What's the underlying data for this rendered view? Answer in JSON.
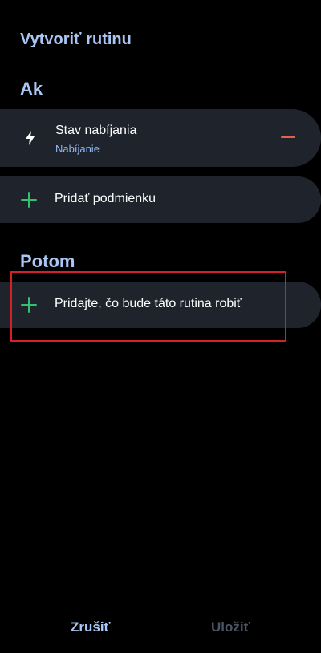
{
  "header": {
    "title": "Vytvoriť rutinu"
  },
  "if_section": {
    "label": "Ak",
    "condition": {
      "icon": "bolt-icon",
      "title": "Stav nabíjania",
      "subtitle": "Nabíjanie",
      "remove_icon": "minus-icon"
    },
    "add_condition_label": "Pridať podmienku"
  },
  "then_section": {
    "label": "Potom",
    "add_action_label": "Pridajte, čo bude táto rutina robiť"
  },
  "footer": {
    "cancel_label": "Zrušiť",
    "save_label": "Uložiť"
  },
  "colors": {
    "background": "#000000",
    "card": "#1f242c",
    "accent_blue": "#a9c6f5",
    "subtitle_blue": "#8fb6f2",
    "plus_green": "#35c070",
    "minus_red": "#e0624f",
    "disabled": "#4b5566",
    "highlight": "#d4202b"
  }
}
